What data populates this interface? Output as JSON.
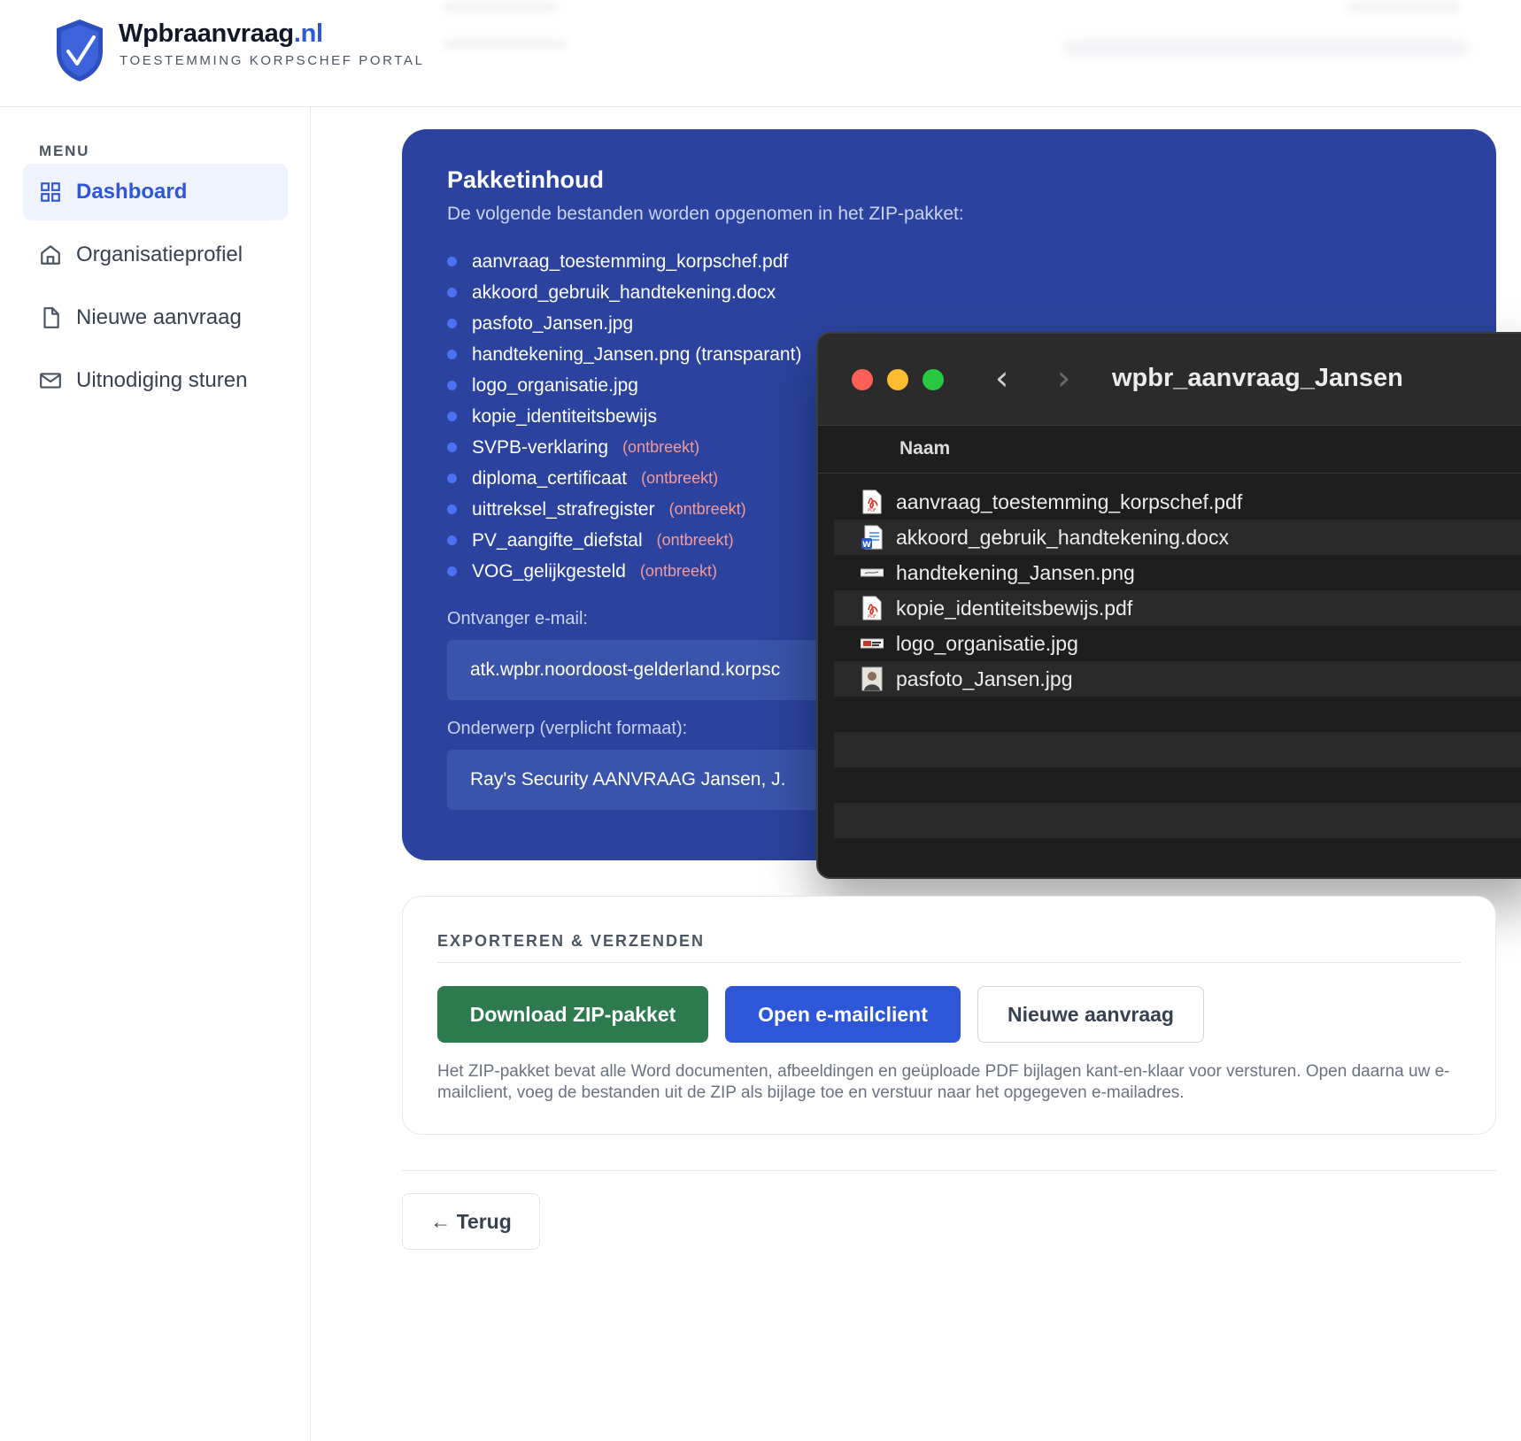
{
  "header": {
    "brand_name": "Wpbraanvraag",
    "brand_tld": ".nl",
    "brand_subtitle": "TOESTEMMING KORPSCHEF PORTAL"
  },
  "sidebar": {
    "menu_label": "MENU",
    "items": [
      {
        "label": "Dashboard",
        "icon": "grid-icon",
        "active": true
      },
      {
        "label": "Organisatieprofiel",
        "icon": "home-icon",
        "active": false
      },
      {
        "label": "Nieuwe aanvraag",
        "icon": "file-icon",
        "active": false
      },
      {
        "label": "Uitnodiging sturen",
        "icon": "mail-icon",
        "active": false
      }
    ]
  },
  "package": {
    "title": "Pakketinhoud",
    "subtitle": "De volgende bestanden worden opgenomen in het ZIP-pakket:",
    "files": [
      {
        "name": "aanvraag_toestemming_korpschef.pdf",
        "status": ""
      },
      {
        "name": "akkoord_gebruik_handtekening.docx",
        "status": ""
      },
      {
        "name": "pasfoto_Jansen.jpg",
        "status": ""
      },
      {
        "name": "handtekening_Jansen.png (transparant)",
        "status": ""
      },
      {
        "name": "logo_organisatie.jpg",
        "status": ""
      },
      {
        "name": "kopie_identiteitsbewijs",
        "status": ""
      },
      {
        "name": "SVPB-verklaring",
        "status": "(ontbreekt)"
      },
      {
        "name": "diploma_certificaat",
        "status": "(ontbreekt)"
      },
      {
        "name": "uittreksel_strafregister",
        "status": "(ontbreekt)"
      },
      {
        "name": "PV_aangifte_diefstal",
        "status": "(ontbreekt)"
      },
      {
        "name": "VOG_gelijkgesteld",
        "status": "(ontbreekt)"
      }
    ],
    "recipient_label": "Ontvanger e-mail:",
    "recipient_value": "atk.wpbr.noordoost-gelderland.korpsc",
    "subject_label": "Onderwerp (verplicht formaat):",
    "subject_value": "Ray's Security AANVRAAG Jansen, J."
  },
  "finder": {
    "title": "wpbr_aanvraag_Jansen",
    "column_name": "Naam",
    "files": [
      {
        "name": "aanvraag_toestemming_korpschef.pdf",
        "icon": "pdf-icon"
      },
      {
        "name": "akkoord_gebruik_handtekening.docx",
        "icon": "word-doc-icon"
      },
      {
        "name": "handtekening_Jansen.png",
        "icon": "png-image-icon"
      },
      {
        "name": "kopie_identiteitsbewijs.pdf",
        "icon": "pdf-icon"
      },
      {
        "name": "logo_organisatie.jpg",
        "icon": "jpg-image-icon"
      },
      {
        "name": "pasfoto_Jansen.jpg",
        "icon": "photo-icon"
      }
    ]
  },
  "export": {
    "title": "EXPORTEREN & VERZENDEN",
    "download_label": "Download ZIP-pakket",
    "email_label": "Open e-mailclient",
    "new_request_label": "Nieuwe aanvraag",
    "note": "Het ZIP-pakket bevat alle Word documenten, afbeeldingen en geüploade PDF bijlagen kant-en-klaar voor versturen. Open daarna uw e-mailclient, voeg de bestanden uit de ZIP als bijlage toe en verstuur naar het opgegeven e-mailadres."
  },
  "back_label": "← Terug",
  "colors": {
    "brand_blue": "#2f56d6",
    "package_bg": "#2b439e",
    "download_green": "#2e7a4f",
    "missing_red": "#f49a9a",
    "finder_bg": "#1e1e1e"
  }
}
